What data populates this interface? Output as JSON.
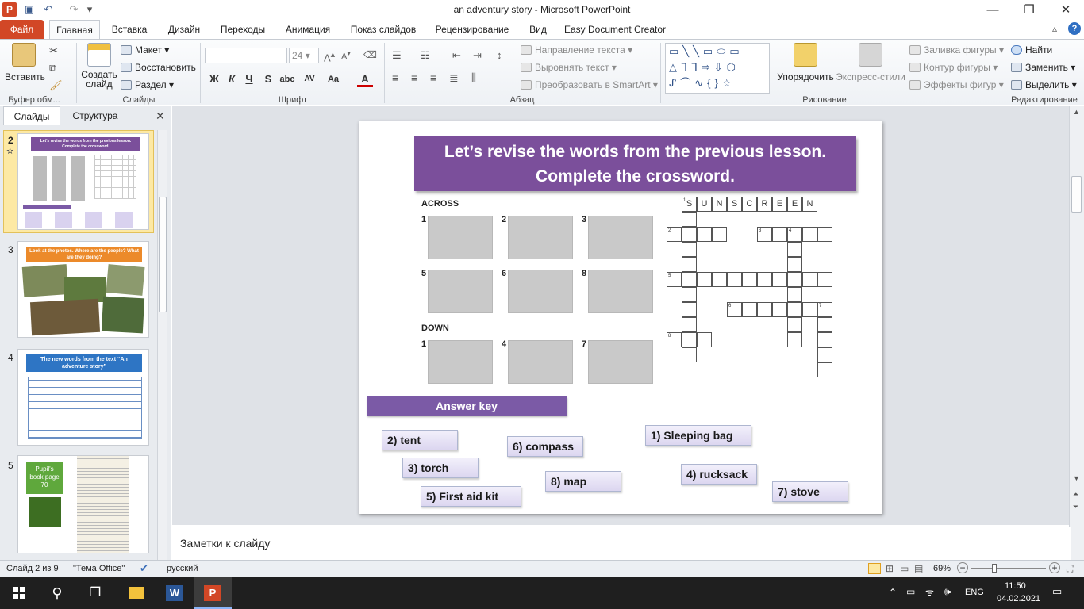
{
  "window": {
    "title": "an adventury story  -  Microsoft PowerPoint"
  },
  "ribbon_tabs": [
    "Файл",
    "Главная",
    "Вставка",
    "Дизайн",
    "Переходы",
    "Анимация",
    "Показ слайдов",
    "Рецензирование",
    "Вид",
    "Easy Document Creator"
  ],
  "ribbon": {
    "clipboard": {
      "paste": "Вставить",
      "group": "Буфер обм..."
    },
    "slides": {
      "new_slide": "Создать слайд",
      "layout": "Макет",
      "reset": "Восстановить",
      "section": "Раздел",
      "group": "Слайды"
    },
    "font": {
      "size": "24",
      "group": "Шрифт"
    },
    "paragraph": {
      "text_dir": "Направление текста",
      "align_text": "Выровнять текст",
      "smartart": "Преобразовать в SmartArt",
      "group": "Абзац"
    },
    "drawing": {
      "arrange": "Упорядочить",
      "quick_styles": "Экспресс-стили",
      "fill": "Заливка фигуры",
      "outline": "Контур фигуры",
      "effects": "Эффекты фигур",
      "group": "Рисование"
    },
    "editing": {
      "find": "Найти",
      "replace": "Заменить",
      "select": "Выделить",
      "group": "Редактирование"
    }
  },
  "left_panel": {
    "tabs": [
      "Слайды",
      "Структура"
    ],
    "thumbnails": [
      {
        "num": "2",
        "title": "Let's revise the words from the previous lesson. Complete the crossword."
      },
      {
        "num": "3",
        "title": "Look at the photos. Where are the people? What are they doing?"
      },
      {
        "num": "4",
        "title": "The new words from the text “An adventure story”"
      },
      {
        "num": "5",
        "title": "Pupil's book page 70"
      }
    ]
  },
  "slide": {
    "title_line1": "Let’s revise the words from the previous lesson.",
    "title_line2": "Complete the crossword.",
    "across_label": "ACROSS",
    "down_label": "DOWN",
    "across_pics": [
      "1",
      "2",
      "3",
      "5",
      "6",
      "8"
    ],
    "down_pics": [
      "1",
      "4",
      "7"
    ],
    "crossword_word": "SUNSCREEN",
    "answer_key": "Answer key",
    "answers": [
      "2) tent",
      "6) compass",
      "1) Sleeping bag",
      "3) torch",
      "8) map",
      "4) rucksack",
      "5) First aid kit",
      "7) stove"
    ]
  },
  "notes": {
    "placeholder": "Заметки к слайду"
  },
  "status": {
    "slide": "Слайд 2 из 9",
    "theme": "\"Тема Office\"",
    "lang": "русский",
    "zoom": "69%"
  },
  "taskbar": {
    "lang": "ENG",
    "time": "11:50",
    "date": "04.02.2021"
  },
  "colors": {
    "accent": "#7b4f9b",
    "file_tab": "#d24726"
  }
}
